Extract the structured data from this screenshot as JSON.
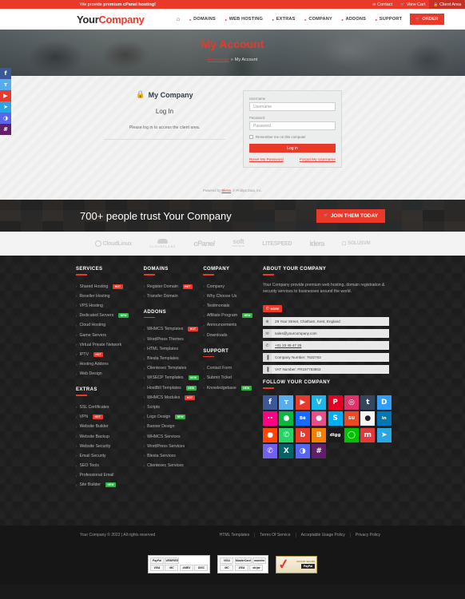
{
  "topbar": {
    "message_prefix": "We provide ",
    "message_bold": "premium cPanel hosting!",
    "links": [
      {
        "label": "Contact",
        "icon": "envelope-icon",
        "glyph": "✉"
      },
      {
        "label": "View Cart",
        "icon": "cart-icon",
        "glyph": "🛒"
      },
      {
        "label": "Client Area",
        "icon": "lock-icon",
        "glyph": "🔒"
      }
    ]
  },
  "header": {
    "logo_part1": "Your",
    "logo_part2": "Company",
    "home_icon": "home-icon",
    "nav": [
      {
        "label": "DOMAINS"
      },
      {
        "label": "WEB HOSTING"
      },
      {
        "label": "EXTRAS"
      },
      {
        "label": "COMPANY"
      },
      {
        "label": "ADDONS"
      },
      {
        "label": "SUPPORT"
      }
    ],
    "order_label": "ORDER"
  },
  "hero": {
    "title": "My Account",
    "breadcrumb_home": "Homepage",
    "breadcrumb_sep": "»",
    "breadcrumb_current": "My Account"
  },
  "login": {
    "lock_icon": "lock-icon",
    "company_name": "My Company",
    "heading": "Log In",
    "description": "Please log in to access the client area.",
    "username_label": "Username",
    "username_placeholder": "Username",
    "password_label": "Password",
    "password_placeholder": "Password",
    "remember_label": "Remember me on this computer",
    "submit_label": "Log in",
    "reset_label": "Reset My Password",
    "forgot_label": "Forgot My Username",
    "powered_prefix": "Powered by ",
    "powered_link": "Blesta",
    "powered_suffix": ", © Phillips Data, Inc."
  },
  "cta": {
    "text": "700+ people trust Your Company",
    "button_label": "JOIN THEM TODAY",
    "button_icon": "cart-icon",
    "accent": "#e8392a"
  },
  "brands": [
    {
      "name": "CloudLinux"
    },
    {
      "name": "CLOUDFLARE"
    },
    {
      "name": "cPanel"
    },
    {
      "name": "soft",
      "sub": "aculous"
    },
    {
      "name": "LITESPEED"
    },
    {
      "name": "idera"
    },
    {
      "name": "SOLUSVM"
    }
  ],
  "footer": {
    "col_services": {
      "title": "SERVICES",
      "items": [
        {
          "label": "Shared Hosting",
          "tag": "HOT"
        },
        {
          "label": "Reseller Hosting"
        },
        {
          "label": "VPS Hosting"
        },
        {
          "label": "Dedicated Servers",
          "tag": "NEW"
        },
        {
          "label": "Cloud Hosting"
        },
        {
          "label": "Game Servers"
        },
        {
          "label": "Virtual Private Network"
        },
        {
          "label": "IPTV",
          "tag": "HOT"
        },
        {
          "label": "Hosting Addons"
        },
        {
          "label": "Web Design"
        }
      ]
    },
    "col_extras": {
      "title": "EXTRAS",
      "items": [
        {
          "label": "SSL Certificates"
        },
        {
          "label": "VPN",
          "tag": "HOT"
        },
        {
          "label": "Website Builder"
        },
        {
          "label": "Website Backup"
        },
        {
          "label": "Website Security"
        },
        {
          "label": "Email Security"
        },
        {
          "label": "SEO Tools"
        },
        {
          "label": "Professional Email"
        },
        {
          "label": "Site Builder",
          "tag": "NEW"
        }
      ]
    },
    "col_domains": {
      "title": "DOMAINS",
      "items": [
        {
          "label": "Register Domain",
          "tag": "HOT"
        },
        {
          "label": "Transfer Domain"
        }
      ]
    },
    "col_addons": {
      "title": "ADDONS",
      "items": [
        {
          "label": "WHMCS Templates",
          "tag": "HOT"
        },
        {
          "label": "WordPress Themes"
        },
        {
          "label": "HTML Templates"
        },
        {
          "label": "Blesta Templates"
        },
        {
          "label": "Clientexec Templates"
        },
        {
          "label": "WISECP Templates",
          "tag": "NEW"
        },
        {
          "label": "HostBill Templates",
          "tag": "NEW"
        },
        {
          "label": "WHMCS Modules",
          "tag": "HOT"
        },
        {
          "label": "Scripts"
        },
        {
          "label": "Logo Design",
          "tag": "NEW"
        },
        {
          "label": "Banner Design"
        },
        {
          "label": "WHMCS Services"
        },
        {
          "label": "WordPress Services"
        },
        {
          "label": "Blesta Services"
        },
        {
          "label": "Clientexec Services"
        }
      ]
    },
    "col_company": {
      "title": "COMPANY",
      "items": [
        {
          "label": "Company"
        },
        {
          "label": "Why Choose Us"
        },
        {
          "label": "Testimonials"
        },
        {
          "label": "Affiliate Program",
          "tag": "NEW"
        },
        {
          "label": "Announcements"
        },
        {
          "label": "Downloads"
        }
      ]
    },
    "col_support": {
      "title": "SUPPORT",
      "items": [
        {
          "label": "Contact Form"
        },
        {
          "label": "Submit Ticket"
        },
        {
          "label": "Knowledgebase",
          "tag": "NEW"
        }
      ]
    },
    "about": {
      "title": "ABOUT YOUR COMPANY",
      "text": "Your Company provide premium web hosting, domain registration & security services to businesses around the world.",
      "more_label": "MORE",
      "more_icon": "info-icon",
      "rows": [
        {
          "icon": "globe-icon",
          "glyph": "⊕",
          "text": "29 Your Street, Chatham, Kent, England",
          "link": false
        },
        {
          "icon": "envelope-icon",
          "glyph": "✉",
          "text": "sales@yourcompany.com",
          "link": false
        },
        {
          "icon": "phone-icon",
          "glyph": "✆",
          "text": "+01 23 45 47 25",
          "link": true
        },
        {
          "icon": "building-icon",
          "glyph": "▐",
          "text": "Company Number: 7632763",
          "link": false
        },
        {
          "icon": "building-icon",
          "glyph": "▐",
          "text": "VAT Number: FR197763863",
          "link": false
        }
      ]
    },
    "follow": {
      "title": "FOLLOW YOUR COMPANY",
      "icons": [
        {
          "name": "facebook-icon",
          "glyph": "f",
          "color": "#3b5998"
        },
        {
          "name": "twitter-icon",
          "glyph": "ᴛ",
          "color": "#55acee"
        },
        {
          "name": "youtube-icon",
          "glyph": "▶",
          "color": "#e8392a"
        },
        {
          "name": "vimeo-icon",
          "glyph": "V",
          "color": "#1ab7ea"
        },
        {
          "name": "pinterest-icon",
          "glyph": "P",
          "color": "#e60023"
        },
        {
          "name": "instagram-icon",
          "glyph": "◎",
          "color": "#e1306c"
        },
        {
          "name": "tumblr-icon",
          "glyph": "t",
          "color": "#35465c"
        },
        {
          "name": "disqus-icon",
          "glyph": "D",
          "color": "#2e9fff"
        },
        {
          "name": "flickr-icon",
          "glyph": "••",
          "color": "#ff0084"
        },
        {
          "name": "wechat-icon",
          "glyph": "●",
          "color": "#09b83e"
        },
        {
          "name": "behance-icon",
          "glyph": "Bē",
          "color": "#1769ff"
        },
        {
          "name": "dribbble-icon",
          "glyph": "●",
          "color": "#ea4c89"
        },
        {
          "name": "skype-icon",
          "glyph": "S",
          "color": "#00aff0"
        },
        {
          "name": "stumbleupon-icon",
          "glyph": "SU",
          "color": "#eb4924"
        },
        {
          "name": "github-icon",
          "glyph": "●",
          "color": "#f5f5f5"
        },
        {
          "name": "linkedin-icon",
          "glyph": "in",
          "color": "#0077b5"
        },
        {
          "name": "reddit-icon",
          "glyph": "●",
          "color": "#ff4500"
        },
        {
          "name": "whatsapp-icon",
          "glyph": "✆",
          "color": "#25d366"
        },
        {
          "name": "bloglovin-icon",
          "glyph": "b",
          "color": "#e8392a"
        },
        {
          "name": "blogger-icon",
          "glyph": "B",
          "color": "#f57d00"
        },
        {
          "name": "digg-icon",
          "glyph": "digg",
          "color": "#1a1a1a"
        },
        {
          "name": "line-icon",
          "glyph": "◯",
          "color": "#00c300"
        },
        {
          "name": "meetup-icon",
          "glyph": "m",
          "color": "#e0393e"
        },
        {
          "name": "telegram-icon",
          "glyph": "➤",
          "color": "#2ca5e0"
        },
        {
          "name": "viber-icon",
          "glyph": "✆",
          "color": "#7360f2"
        },
        {
          "name": "xing-icon",
          "glyph": "X",
          "color": "#026466"
        },
        {
          "name": "discord-icon",
          "glyph": "◑",
          "color": "#5865f2"
        },
        {
          "name": "slack-icon",
          "glyph": "#",
          "color": "#611f69"
        }
      ]
    }
  },
  "bottom": {
    "copyright": "Your Company © 2022 | All rights reserved",
    "links": [
      {
        "label": "HTML Templates"
      },
      {
        "label": "Terms Of Service"
      },
      {
        "label": "Acceptable Usage Policy"
      },
      {
        "label": "Privacy Policy"
      }
    ]
  },
  "payments": {
    "card1": [
      "PayPal",
      "VERIFIED",
      "VISA",
      "MC",
      "AMEX",
      "DISC"
    ],
    "card2": [
      "VISA",
      "MasterCard",
      "maestro",
      "MC",
      "VISA",
      "stripe"
    ],
    "seal_label": "PayPal",
    "seal_sub": "OFFICIAL SECURE"
  },
  "rail": [
    {
      "name": "facebook-rail-icon",
      "glyph": "f",
      "color": "#3b5998"
    },
    {
      "name": "twitter-rail-icon",
      "glyph": "ᴛ",
      "color": "#55acee"
    },
    {
      "name": "youtube-rail-icon",
      "glyph": "▶",
      "color": "#e8392a"
    },
    {
      "name": "telegram-rail-icon",
      "glyph": "➤",
      "color": "#2ca5e0"
    },
    {
      "name": "discord-rail-icon",
      "glyph": "◑",
      "color": "#5865f2"
    },
    {
      "name": "slack-rail-icon",
      "glyph": "#",
      "color": "#611f69"
    }
  ]
}
